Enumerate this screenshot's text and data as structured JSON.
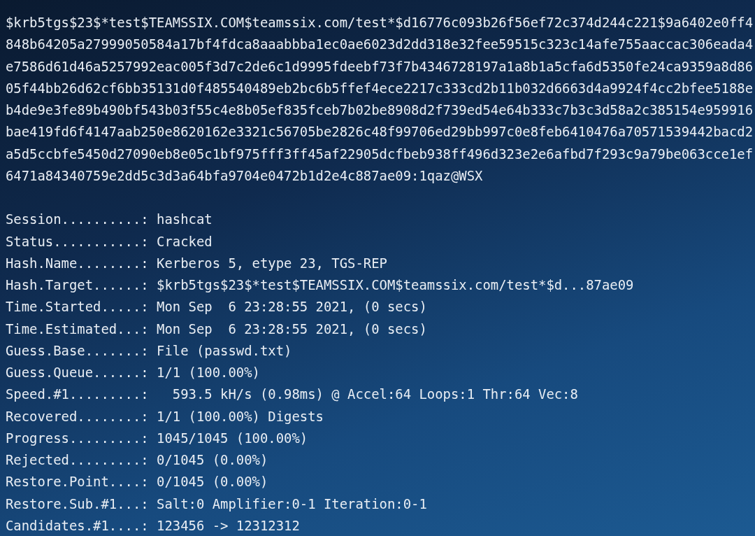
{
  "hash_output": [
    "$krb5tgs$23$*test$TEAMSSIX.COM$teamssix.com/test*$d16776c093b26f56ef72c374d244c221$9a6402e0ff4",
    "848b64205a27999050584a17bf4fdca8aaabbba1ec0ae6023d2dd318e32fee59515c323c14afe755aaccac306eada4",
    "e7586d61d46a5257992eac005f3d7c2de6c1d9995fdeebf73f7b4346728197a1a8b1a5cfa6d5350fe24ca9359a8d86",
    "05f44bb26d62cf6bb35131d0f485540489eb2bc6b5ffef4ece2217c333cd2b11b032d6663d4a9924f4cc2bfee5188e",
    "b4de9e3fe89b490bf543b03f55c4e8b05ef835fceb7b02be8908d2f739ed54e64b333c7b3c3d58a2c385154e959916",
    "bae419fd6f4147aab250e8620162e3321c56705be2826c48f99706ed29bb997c0e8feb6410476a70571539442bacd2",
    "a5d5ccbfe5450d27090eb8e05c1bf975fff3ff45af22905dcfbeb938ff496d323e2e6afbd7f293c9a79be063cce1ef",
    "6471a84340759e2dd5c3d3a64bfa9704e0472b1d2e4c887ae09:1qaz@WSX"
  ],
  "status": [
    {
      "label": "Session..........:",
      "value": "hashcat"
    },
    {
      "label": "Status...........:",
      "value": "Cracked"
    },
    {
      "label": "Hash.Name........:",
      "value": "Kerberos 5, etype 23, TGS-REP"
    },
    {
      "label": "Hash.Target......:",
      "value": "$krb5tgs$23$*test$TEAMSSIX.COM$teamssix.com/test*$d...87ae09"
    },
    {
      "label": "Time.Started.....:",
      "value": "Mon Sep  6 23:28:55 2021, (0 secs)"
    },
    {
      "label": "Time.Estimated...:",
      "value": "Mon Sep  6 23:28:55 2021, (0 secs)"
    },
    {
      "label": "Guess.Base.......:",
      "value": "File (passwd.txt)"
    },
    {
      "label": "Guess.Queue......:",
      "value": "1/1 (100.00%)"
    },
    {
      "label": "Speed.#1.........:",
      "value": "  593.5 kH/s (0.98ms) @ Accel:64 Loops:1 Thr:64 Vec:8"
    },
    {
      "label": "Recovered........:",
      "value": "1/1 (100.00%) Digests"
    },
    {
      "label": "Progress.........:",
      "value": "1045/1045 (100.00%)"
    },
    {
      "label": "Rejected.........:",
      "value": "0/1045 (0.00%)"
    },
    {
      "label": "Restore.Point....:",
      "value": "0/1045 (0.00%)"
    },
    {
      "label": "Restore.Sub.#1...:",
      "value": "Salt:0 Amplifier:0-1 Iteration:0-1"
    },
    {
      "label": "Candidates.#1....:",
      "value": "123456 -> 12312312"
    }
  ]
}
